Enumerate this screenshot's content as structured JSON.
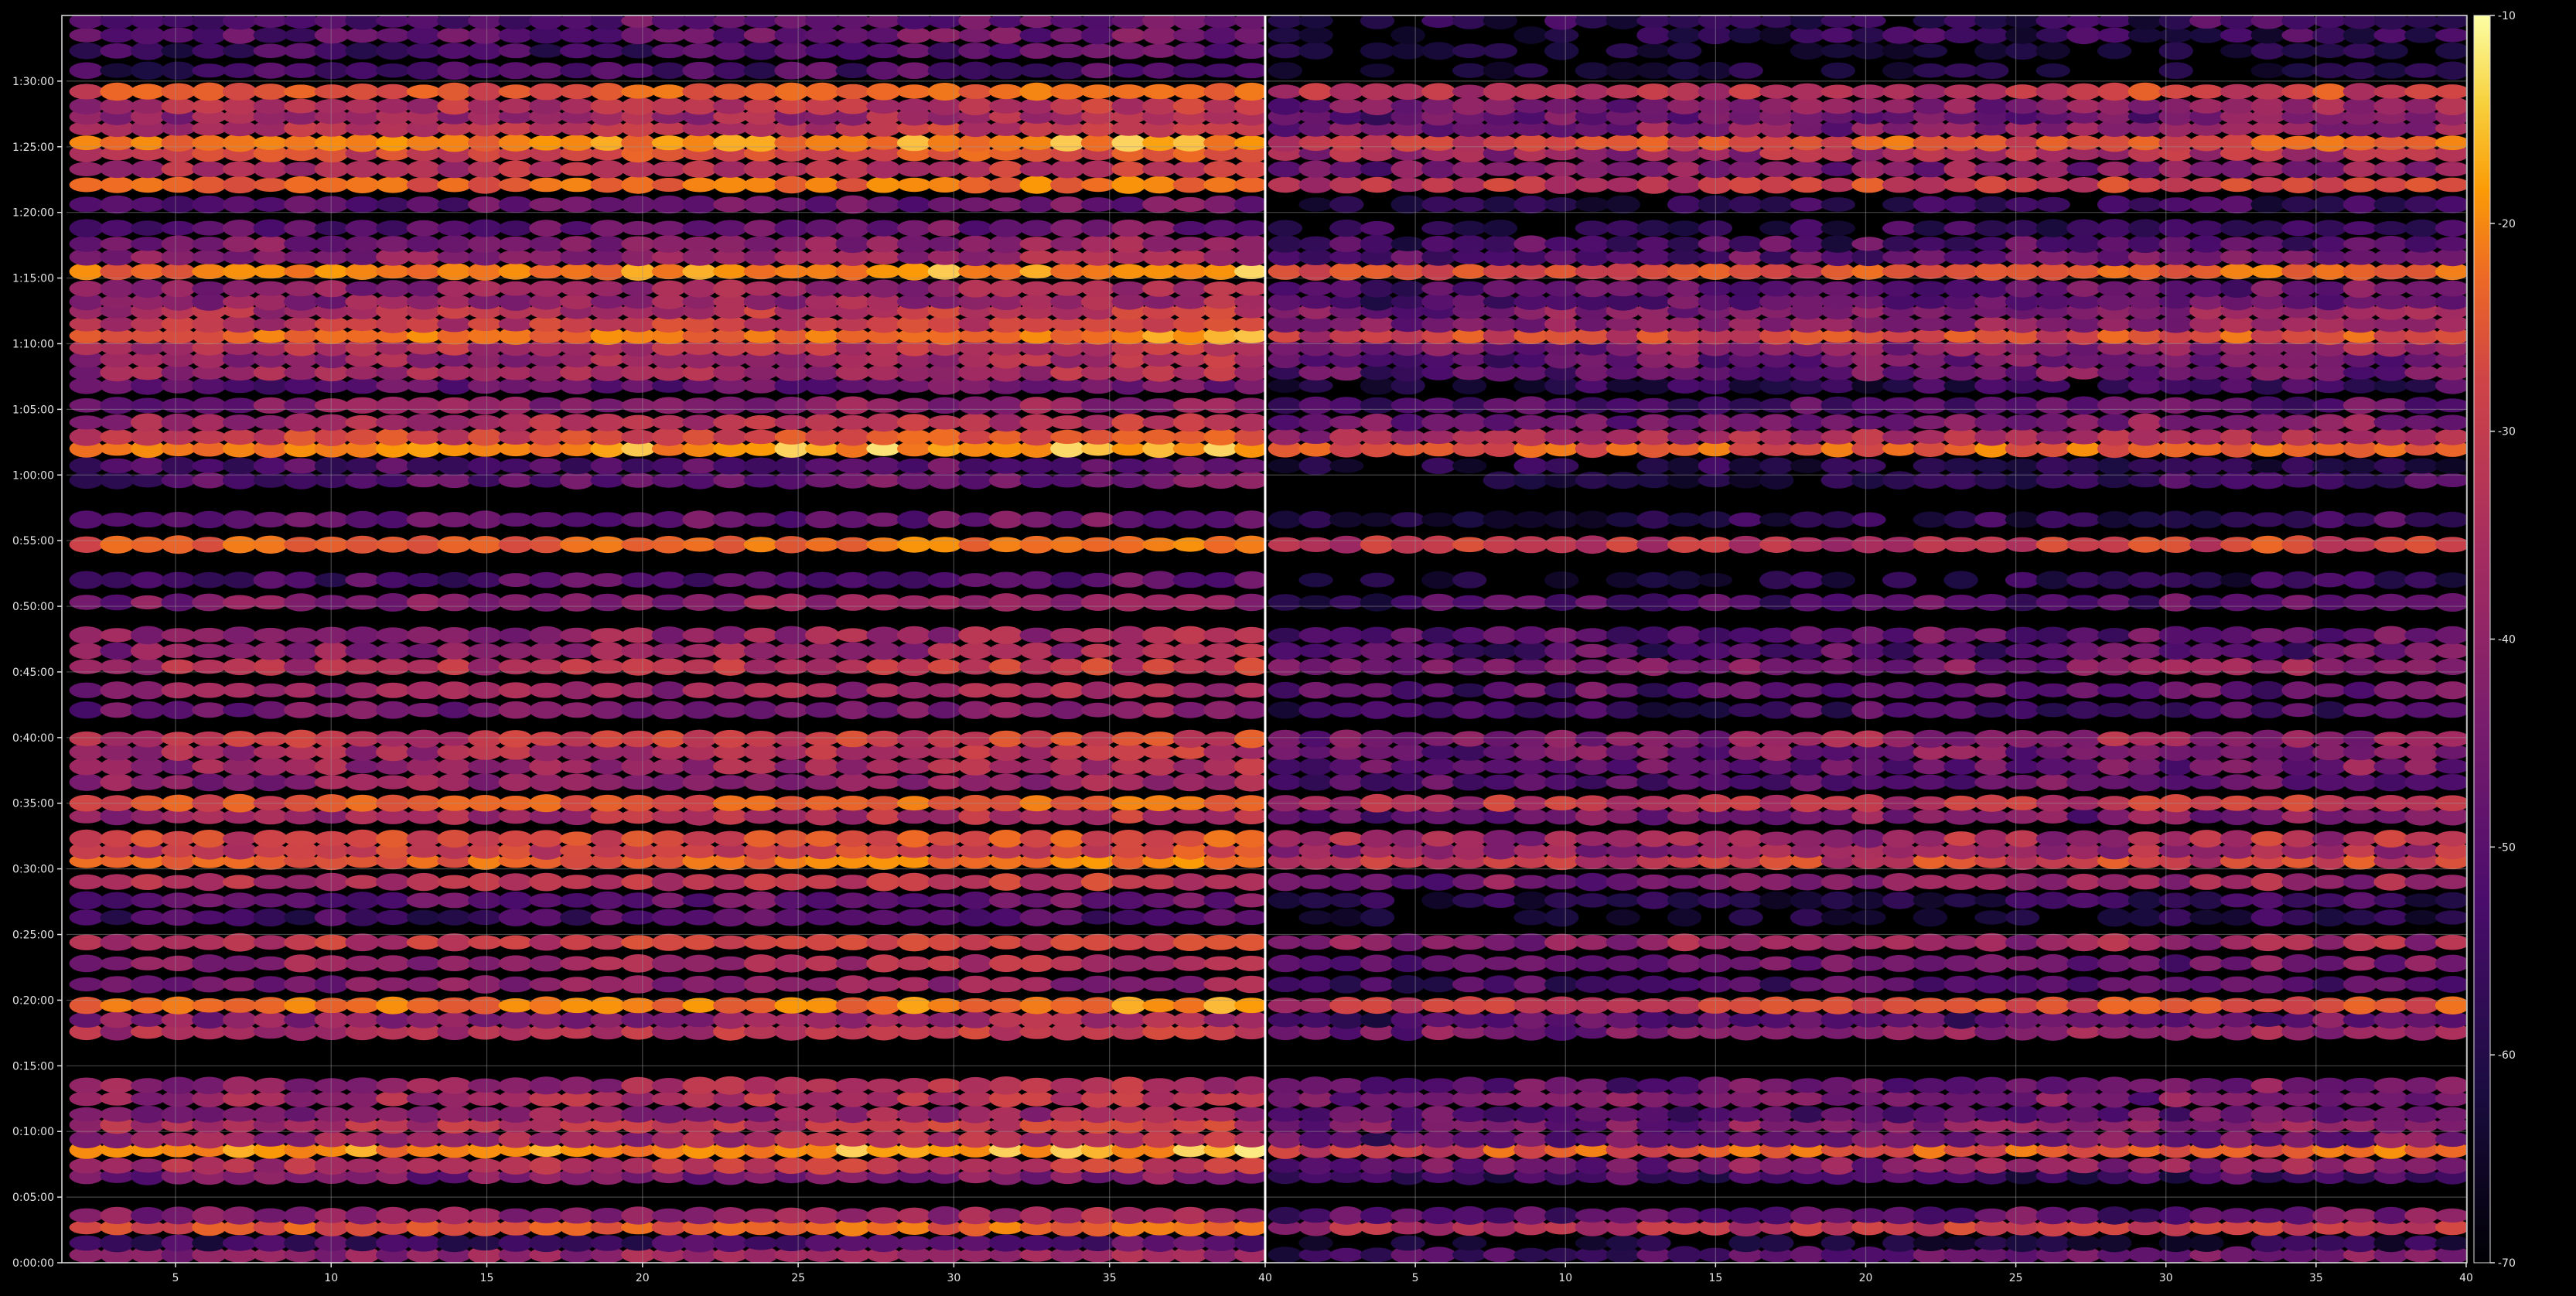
{
  "chart_data": {
    "type": "heatmap",
    "title": "",
    "xlabel": "",
    "ylabel": "",
    "background": "#000000",
    "grid": true,
    "grid_color": "#9a9a9a",
    "colormap": "inferno",
    "colorbar": {
      "min": -70,
      "max": -10,
      "ticks": [
        -70,
        -60,
        -50,
        -40,
        -30,
        -20,
        -10
      ],
      "placement": "right"
    },
    "y_axis": {
      "range_minutes": [
        0,
        95
      ],
      "tick_labels": [
        "0:00:00",
        "0:05:00",
        "0:10:00",
        "0:15:00",
        "0:20:00",
        "0:25:00",
        "0:30:00",
        "0:35:00",
        "0:40:00",
        "0:45:00",
        "0:50:00",
        "0:55:00",
        "1:00:00",
        "1:05:00",
        "1:10:00",
        "1:15:00",
        "1:20:00",
        "1:25:00",
        "1:30:00"
      ]
    },
    "panels": [
      {
        "xlim": [
          1.5,
          40
        ],
        "x_ticks": [
          5,
          10,
          15,
          20,
          25,
          30,
          35,
          40
        ],
        "variant": "full"
      },
      {
        "xlim": [
          40,
          80
        ],
        "x_ticks": [
          5,
          10,
          15,
          20,
          25,
          30,
          35,
          40
        ],
        "variant": "quiet"
      }
    ],
    "bands": [
      {
        "t": 0.6,
        "v": -46
      },
      {
        "t": 1.5,
        "v": -58
      },
      {
        "t": 2.7,
        "v": -30
      },
      {
        "t": 3.6,
        "v": -46
      },
      {
        "t": 6.6,
        "v": -50
      },
      {
        "t": 7.4,
        "v": -40
      },
      {
        "t": 8.6,
        "v": -22
      },
      {
        "t": 9.4,
        "v": -44
      },
      {
        "t": 10.5,
        "v": -40
      },
      {
        "t": 11.3,
        "v": -46
      },
      {
        "t": 12.5,
        "v": -42
      },
      {
        "t": 13.5,
        "v": -44
      },
      {
        "t": 17.6,
        "v": -40
      },
      {
        "t": 18.5,
        "v": -46
      },
      {
        "t": 19.6,
        "v": -26
      },
      {
        "t": 21.2,
        "v": -48
      },
      {
        "t": 22.8,
        "v": -44
      },
      {
        "t": 24.4,
        "v": -38
      },
      {
        "t": 26.3,
        "v": -58
      },
      {
        "t": 27.6,
        "v": -54
      },
      {
        "t": 29.0,
        "v": -40
      },
      {
        "t": 30.6,
        "v": -28
      },
      {
        "t": 31.4,
        "v": -36
      },
      {
        "t": 32.3,
        "v": -34
      },
      {
        "t": 34.0,
        "v": -42
      },
      {
        "t": 35.0,
        "v": -30
      },
      {
        "t": 36.6,
        "v": -46
      },
      {
        "t": 37.8,
        "v": -44
      },
      {
        "t": 38.9,
        "v": -42
      },
      {
        "t": 39.9,
        "v": -38
      },
      {
        "t": 42.1,
        "v": -50
      },
      {
        "t": 43.6,
        "v": -46
      },
      {
        "t": 45.4,
        "v": -40
      },
      {
        "t": 46.6,
        "v": -46
      },
      {
        "t": 47.8,
        "v": -46
      },
      {
        "t": 50.3,
        "v": -48
      },
      {
        "t": 52.0,
        "v": -56
      },
      {
        "t": 54.7,
        "v": -28
      },
      {
        "t": 56.6,
        "v": -54
      },
      {
        "t": 59.6,
        "v": -54
      },
      {
        "t": 60.7,
        "v": -56
      },
      {
        "t": 62.0,
        "v": -22
      },
      {
        "t": 62.9,
        "v": -34
      },
      {
        "t": 64.0,
        "v": -42
      },
      {
        "t": 65.3,
        "v": -48
      },
      {
        "t": 66.8,
        "v": -54
      },
      {
        "t": 67.8,
        "v": -44
      },
      {
        "t": 68.8,
        "v": -44
      },
      {
        "t": 69.7,
        "v": -40
      },
      {
        "t": 70.6,
        "v": -26
      },
      {
        "t": 71.5,
        "v": -38
      },
      {
        "t": 72.5,
        "v": -40
      },
      {
        "t": 73.2,
        "v": -46
      },
      {
        "t": 74.2,
        "v": -46
      },
      {
        "t": 75.5,
        "v": -24
      },
      {
        "t": 76.6,
        "v": -46
      },
      {
        "t": 77.6,
        "v": -48
      },
      {
        "t": 78.8,
        "v": -54
      },
      {
        "t": 80.6,
        "v": -54
      },
      {
        "t": 82.1,
        "v": -28
      },
      {
        "t": 83.3,
        "v": -40
      },
      {
        "t": 84.5,
        "v": -34
      },
      {
        "t": 85.3,
        "v": -24
      },
      {
        "t": 86.4,
        "v": -40
      },
      {
        "t": 87.3,
        "v": -44
      },
      {
        "t": 88.1,
        "v": -40
      },
      {
        "t": 89.2,
        "v": -30
      },
      {
        "t": 90.8,
        "v": -58
      },
      {
        "t": 92.3,
        "v": -58
      },
      {
        "t": 93.5,
        "v": -54
      },
      {
        "t": 94.6,
        "v": -54
      }
    ]
  }
}
